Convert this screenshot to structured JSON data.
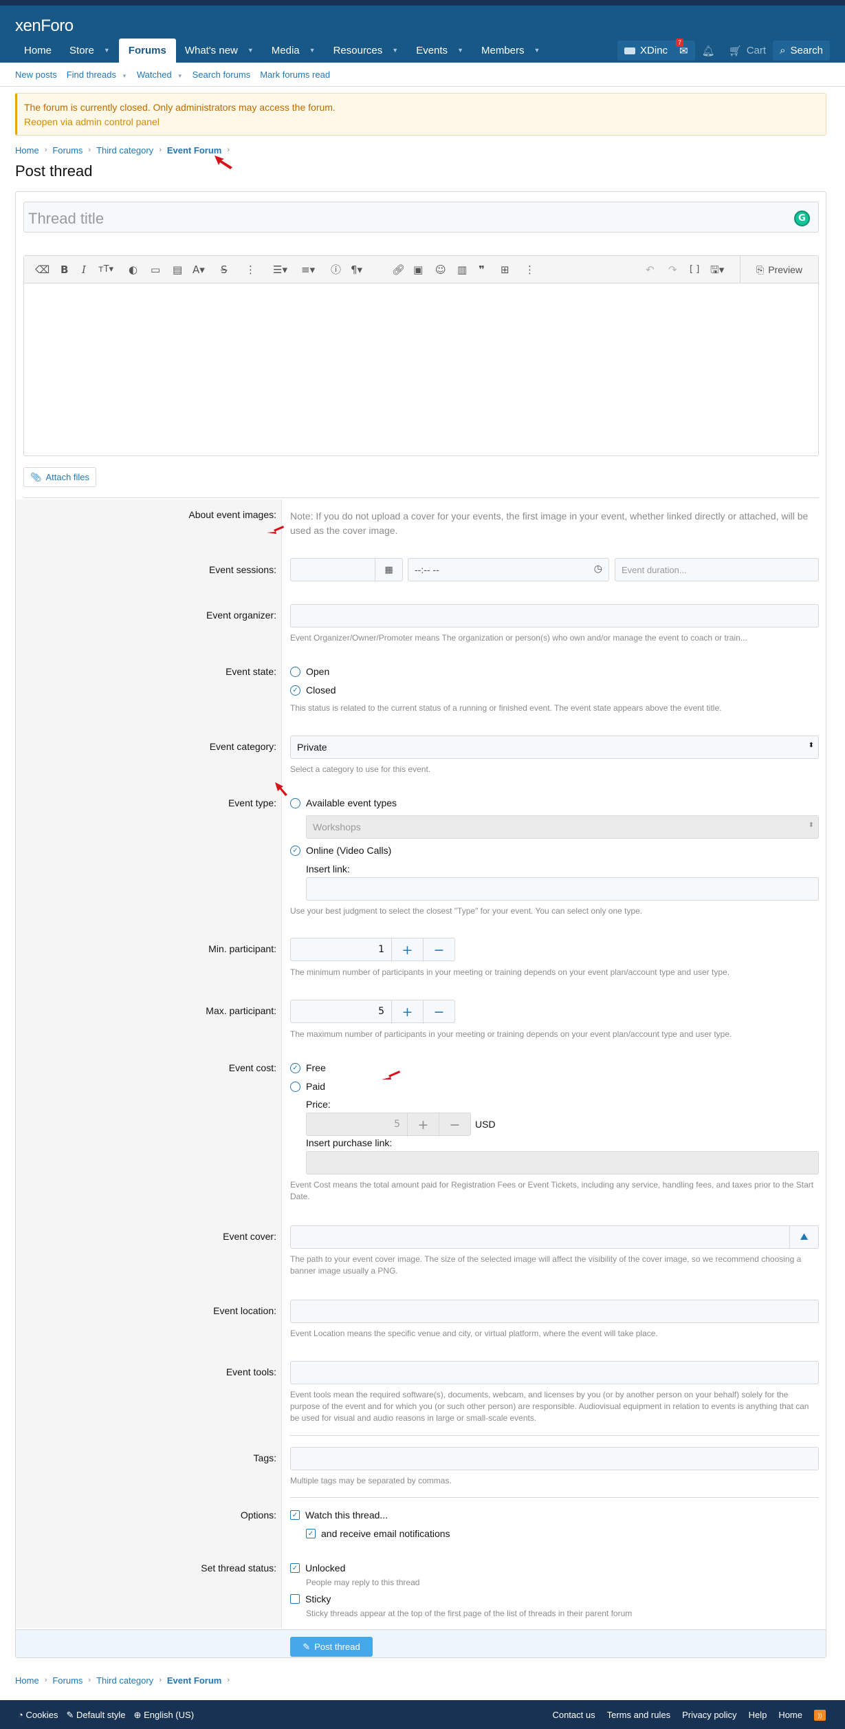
{
  "header": {
    "logo": "xenForo",
    "nav": [
      {
        "label": "Home",
        "caret": false
      },
      {
        "label": "Store",
        "caret": true
      },
      {
        "label": "Forums",
        "caret": false,
        "active": true
      },
      {
        "label": "What's new",
        "caret": true
      },
      {
        "label": "Media",
        "caret": true
      },
      {
        "label": "Resources",
        "caret": true
      },
      {
        "label": "Events",
        "caret": true
      },
      {
        "label": "Members",
        "caret": true
      }
    ],
    "user": "XDinc",
    "inbox_count": "7",
    "cart": "Cart",
    "search": "Search"
  },
  "subnav": [
    "New posts",
    "Find threads",
    "Watched",
    "Search forums",
    "Mark forums read"
  ],
  "notice": {
    "line1": "The forum is currently closed. Only administrators may access the forum.",
    "line2": "Reopen via admin control panel"
  },
  "breadcrumb": [
    "Home",
    "Forums",
    "Third category",
    "Event Forum"
  ],
  "page_title": "Post thread",
  "thread_title_placeholder": "Thread title",
  "editor": {
    "preview": "Preview"
  },
  "attach_label": "Attach files",
  "form": {
    "about_images_label": "About event images:",
    "about_images_note": "Note: If you do not upload a cover for your events, the first image in your event, whether linked directly or attached, will be used as the cover image.",
    "sessions_label": "Event sessions:",
    "time_placeholder": "--:-- --",
    "duration_placeholder": "Event duration...",
    "organizer_label": "Event organizer:",
    "organizer_hint": "Event Organizer/Owner/Promoter means The organization or person(s) who own and/or manage the event to coach or train...",
    "state_label": "Event state:",
    "state_open": "Open",
    "state_closed": "Closed",
    "state_hint": "This status is related to the current status of a running or finished event. The event state appears above the event title.",
    "category_label": "Event category:",
    "category_value": "Private",
    "category_hint": "Select a category to use for this event.",
    "type_label": "Event type:",
    "type_available": "Available event types",
    "type_select_value": "Workshops",
    "type_online": "Online (Video Calls)",
    "insert_link_label": "Insert link:",
    "type_hint": "Use your best judgment to select the closest \"Type\" for your event. You can select only one type.",
    "min_label": "Min. participant:",
    "min_value": "1",
    "min_hint": "The minimum number of participants in your meeting or training depends on your event plan/account type and user type.",
    "max_label": "Max. participant:",
    "max_value": "5",
    "max_hint": "The maximum number of participants in your meeting or training depends on your event plan/account type and user type.",
    "cost_label": "Event cost:",
    "cost_free": "Free",
    "cost_paid": "Paid",
    "price_label": "Price:",
    "price_value": "5",
    "currency": "USD",
    "purchase_link_label": "Insert purchase link:",
    "cost_hint": "Event Cost means the total amount paid for Registration Fees or Event Tickets, including any service, handling fees, and taxes prior to the Start Date.",
    "cover_label": "Event cover:",
    "cover_hint": "The path to your event cover image. The size of the selected image will affect the visibility of the cover image, so we recommend choosing a banner image usually a PNG.",
    "location_label": "Event location:",
    "location_hint": "Event Location means the specific venue and city, or virtual platform, where the event will take place.",
    "tools_label": "Event tools:",
    "tools_hint": "Event tools mean the required software(s), documents, webcam, and licenses by you (or by another person on your behalf) solely for the purpose of the event and for which you (or such other person) are responsible. Audiovisual equipment in relation to events is anything that can be used for visual and audio reasons in large or small-scale events.",
    "tags_label": "Tags:",
    "tags_hint": "Multiple tags may be separated by commas.",
    "options_label": "Options:",
    "watch_label": "Watch this thread...",
    "email_label": "and receive email notifications",
    "status_label": "Set thread status:",
    "unlocked_label": "Unlocked",
    "unlocked_hint": "People may reply to this thread",
    "sticky_label": "Sticky",
    "sticky_hint": "Sticky threads appear at the top of the first page of the list of threads in their parent forum",
    "submit": "Post thread"
  },
  "footer": {
    "left": [
      "Cookies",
      "Default style",
      "English (US)"
    ],
    "right": [
      "Contact us",
      "Terms and rules",
      "Privacy policy",
      "Help",
      "Home"
    ]
  },
  "colors": {
    "header": "#185886",
    "accent": "#2577b1",
    "button": "#47a7eb"
  }
}
